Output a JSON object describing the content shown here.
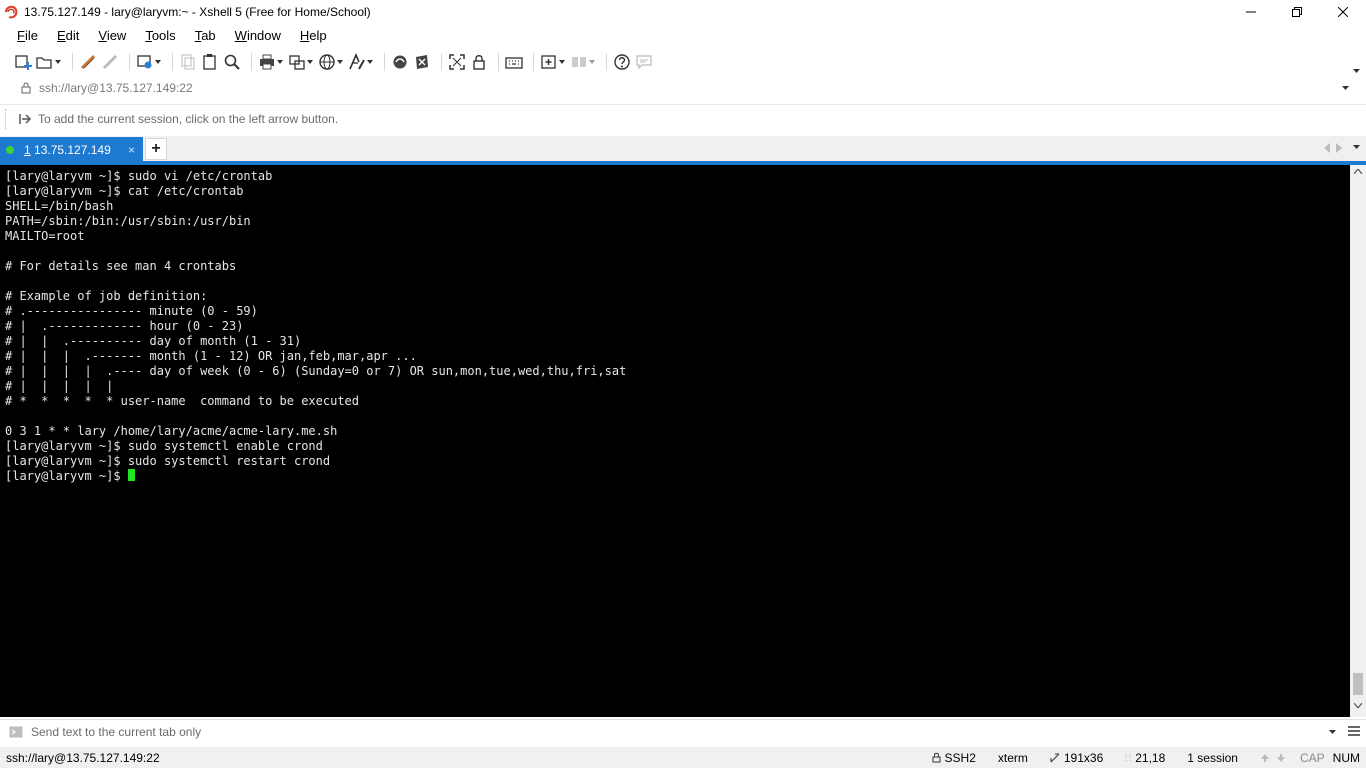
{
  "window": {
    "title": "13.75.127.149 - lary@laryvm:~ - Xshell 5 (Free for Home/School)"
  },
  "menu": {
    "items": [
      {
        "u": "F",
        "rest": "ile"
      },
      {
        "u": "E",
        "rest": "dit"
      },
      {
        "u": "V",
        "rest": "iew"
      },
      {
        "u": "T",
        "rest": "ools"
      },
      {
        "u": "T",
        "rest": "ab"
      },
      {
        "u": "W",
        "rest": "indow"
      },
      {
        "u": "H",
        "rest": "elp"
      }
    ]
  },
  "address": {
    "value": "ssh://lary@13.75.127.149:22"
  },
  "hint": {
    "text": "To add the current session, click on the left arrow button."
  },
  "tabs": {
    "active": {
      "num": "1",
      "label": " 13.75.127.149",
      "close": "×"
    },
    "add": "+"
  },
  "terminal": {
    "lines": [
      "[lary@laryvm ~]$ sudo vi /etc/crontab",
      "[lary@laryvm ~]$ cat /etc/crontab",
      "SHELL=/bin/bash",
      "PATH=/sbin:/bin:/usr/sbin:/usr/bin",
      "MAILTO=root",
      "",
      "# For details see man 4 crontabs",
      "",
      "# Example of job definition:",
      "# .---------------- minute (0 - 59)",
      "# |  .------------- hour (0 - 23)",
      "# |  |  .---------- day of month (1 - 31)",
      "# |  |  |  .------- month (1 - 12) OR jan,feb,mar,apr ...",
      "# |  |  |  |  .---- day of week (0 - 6) (Sunday=0 or 7) OR sun,mon,tue,wed,thu,fri,sat",
      "# |  |  |  |  |",
      "# *  *  *  *  * user-name  command to be executed",
      "",
      "0 3 1 * * lary /home/lary/acme/acme-lary.me.sh",
      "[lary@laryvm ~]$ sudo systemctl enable crond",
      "[lary@laryvm ~]$ sudo systemctl restart crond"
    ],
    "prompt": "[lary@laryvm ~]$ ",
    "cursor_color": "#22e622"
  },
  "compose": {
    "placeholder": "Send text to the current tab only"
  },
  "status": {
    "connection": "ssh://lary@13.75.127.149:22",
    "protocol": "SSH2",
    "terminal_type": "xterm",
    "size": "191x36",
    "position": "21,18",
    "sessions": "1 session",
    "cap": "CAP",
    "num": "NUM"
  },
  "colors": {
    "accent": "#1e7ad1",
    "session_dot": "#39d33b"
  }
}
